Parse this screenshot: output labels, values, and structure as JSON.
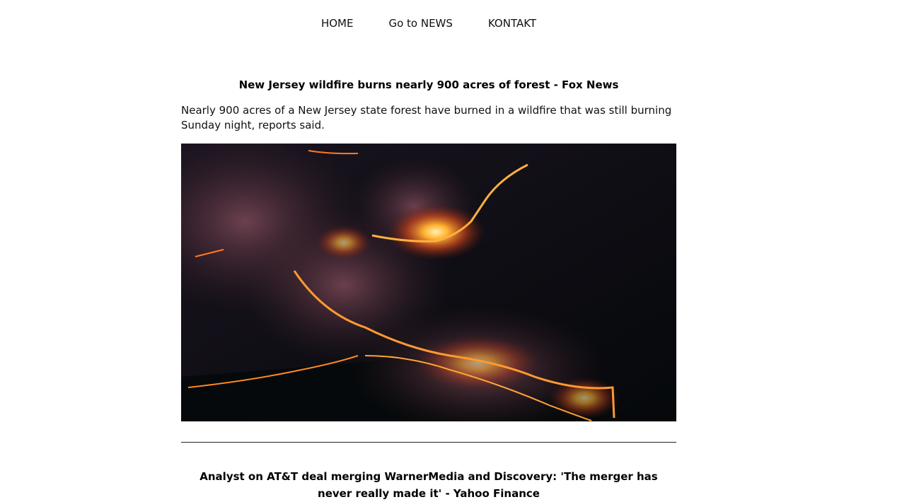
{
  "nav": {
    "items": [
      {
        "label": "HOME"
      },
      {
        "label": "Go to NEWS"
      },
      {
        "label": "KONTAKT"
      }
    ]
  },
  "articles": [
    {
      "headline": "New Jersey wildfire burns nearly 900 acres of forest - Fox News",
      "summary": "Nearly 900 acres of a New Jersey state forest have burned in a wildfire that was still burning Sunday night, reports said.",
      "image_alt": "Aerial night view of wildfire burning through forest with lines of flame and smoke"
    },
    {
      "headline": "Analyst on AT&T deal merging WarnerMedia and Discovery: 'The merger has never really made it' - Yahoo Finance"
    }
  ]
}
